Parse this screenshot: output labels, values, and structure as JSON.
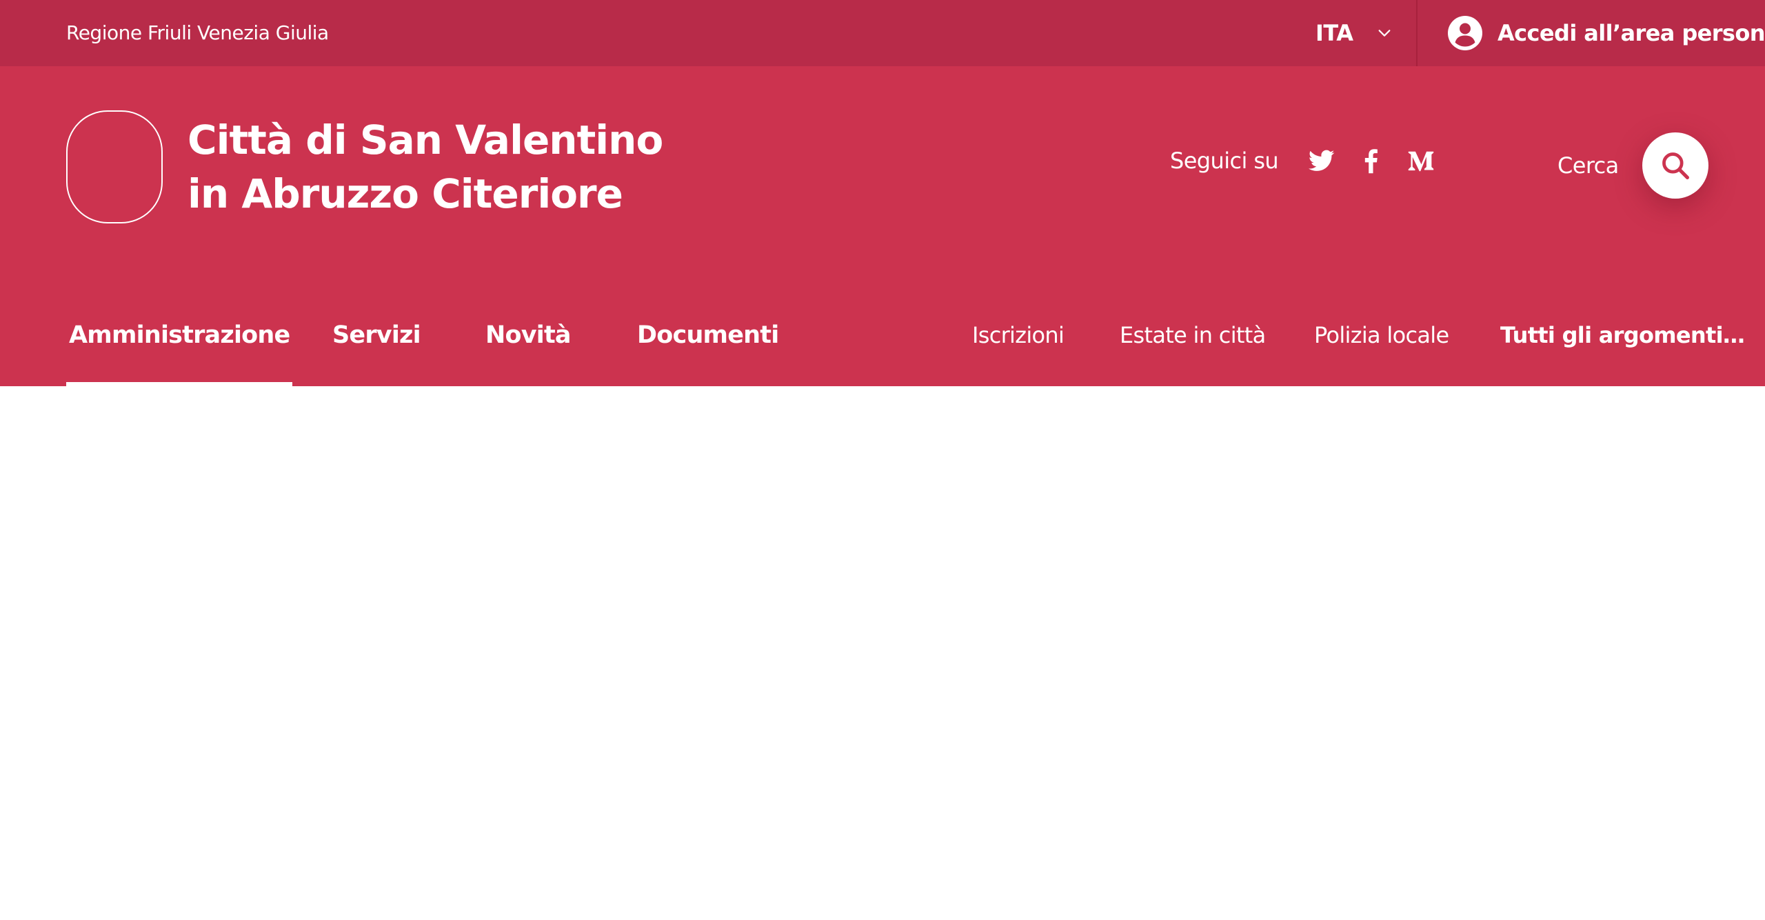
{
  "colors": {
    "slim_bar": "#b82b49",
    "header": "#cc334f",
    "text": "#ffffff",
    "page": "#ffffff"
  },
  "slim_header": {
    "region": "Regione Friuli Venezia Giulia",
    "language": "ITA",
    "language_icon": "chevron-down-icon",
    "login_label": "Accedi all’area personale",
    "login_icon": "user-circle-icon"
  },
  "center_header": {
    "title_line1": "Città di San Valentino",
    "title_line2": "in Abruzzo Citeriore",
    "social_label": "Seguici su",
    "social_icons": [
      "twitter-icon",
      "facebook-icon",
      "medium-icon"
    ],
    "search_label": "Cerca",
    "search_icon": "search-icon"
  },
  "nav": {
    "main": [
      {
        "label": "Amministrazione",
        "active": true
      },
      {
        "label": "Servizi",
        "active": false
      },
      {
        "label": "Novità",
        "active": false
      },
      {
        "label": "Documenti",
        "active": false
      }
    ],
    "secondary": [
      {
        "label": "Iscrizioni"
      },
      {
        "label": "Estate in città"
      },
      {
        "label": "Polizia locale"
      },
      {
        "label": "Tutti gli argomenti…"
      }
    ]
  }
}
